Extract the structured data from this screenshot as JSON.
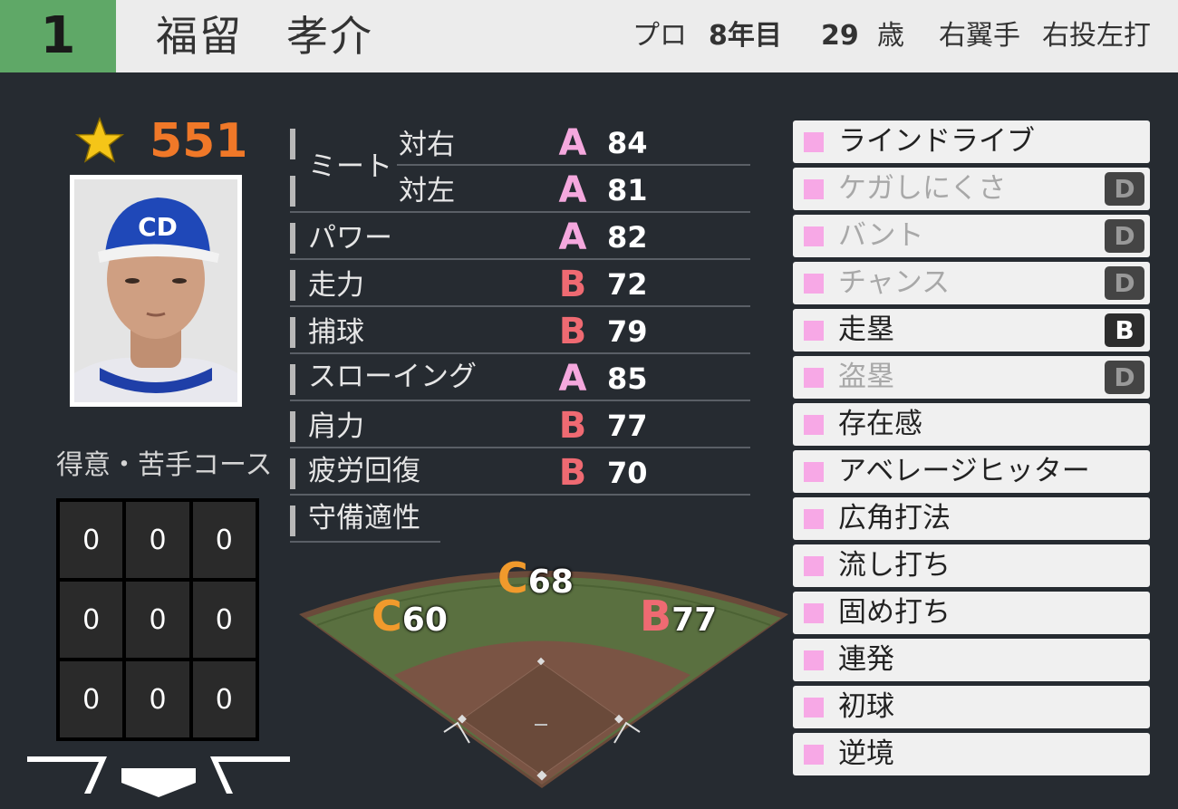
{
  "header": {
    "number": "1",
    "name": "福留　孝介",
    "pro_label": "プロ",
    "years": "8年目",
    "age": "29",
    "age_unit": "歳",
    "position": "右翼手",
    "handedness": "右投左打"
  },
  "overall": {
    "value": "551",
    "star_color": "#f5c518"
  },
  "course": {
    "label": "得意・苦手コース",
    "cells": [
      "0",
      "0",
      "0",
      "0",
      "0",
      "0",
      "0",
      "0",
      "0"
    ]
  },
  "stats": {
    "meet_label": "ミート",
    "meet_right_label": "対右",
    "meet_right_rank": "A",
    "meet_right_value": "84",
    "meet_left_label": "対左",
    "meet_left_rank": "A",
    "meet_left_value": "81",
    "power_label": "パワー",
    "power_rank": "A",
    "power_value": "82",
    "speed_label": "走力",
    "speed_rank": "B",
    "speed_value": "72",
    "catching_label": "捕球",
    "catching_rank": "B",
    "catching_value": "79",
    "throwing_label": "スローイング",
    "throwing_rank": "A",
    "throwing_value": "85",
    "arm_label": "肩力",
    "arm_rank": "B",
    "arm_value": "77",
    "recovery_label": "疲労回復",
    "recovery_rank": "B",
    "recovery_value": "70",
    "defense_label": "守備適性"
  },
  "field": {
    "left_rank": "C",
    "left_value": "60",
    "center_rank": "C",
    "center_value": "68",
    "right_rank": "B",
    "right_value": "77"
  },
  "abilities": [
    {
      "name": "ラインドライブ",
      "grade": "",
      "dim": false
    },
    {
      "name": "ケガしにくさ",
      "grade": "D",
      "dim": true
    },
    {
      "name": "バント",
      "grade": "D",
      "dim": true
    },
    {
      "name": "チャンス",
      "grade": "D",
      "dim": true
    },
    {
      "name": "走塁",
      "grade": "B",
      "dim": false
    },
    {
      "name": "盗塁",
      "grade": "D",
      "dim": true
    },
    {
      "name": "存在感",
      "grade": "",
      "dim": false
    },
    {
      "name": "アベレージヒッター",
      "grade": "",
      "dim": false
    },
    {
      "name": "広角打法",
      "grade": "",
      "dim": false
    },
    {
      "name": "流し打ち",
      "grade": "",
      "dim": false
    },
    {
      "name": "固め打ち",
      "grade": "",
      "dim": false
    },
    {
      "name": "連発",
      "grade": "",
      "dim": false
    },
    {
      "name": "初球",
      "grade": "",
      "dim": false
    },
    {
      "name": "逆境",
      "grade": "",
      "dim": false
    }
  ],
  "colors": {
    "header_number_bg": "#5fa867",
    "overall": "#f07828",
    "rank_a": "#f5a8de",
    "rank_b": "#ef6a72",
    "rank_c": "#f19a2c",
    "ability_marker": "#f7a8e6"
  }
}
